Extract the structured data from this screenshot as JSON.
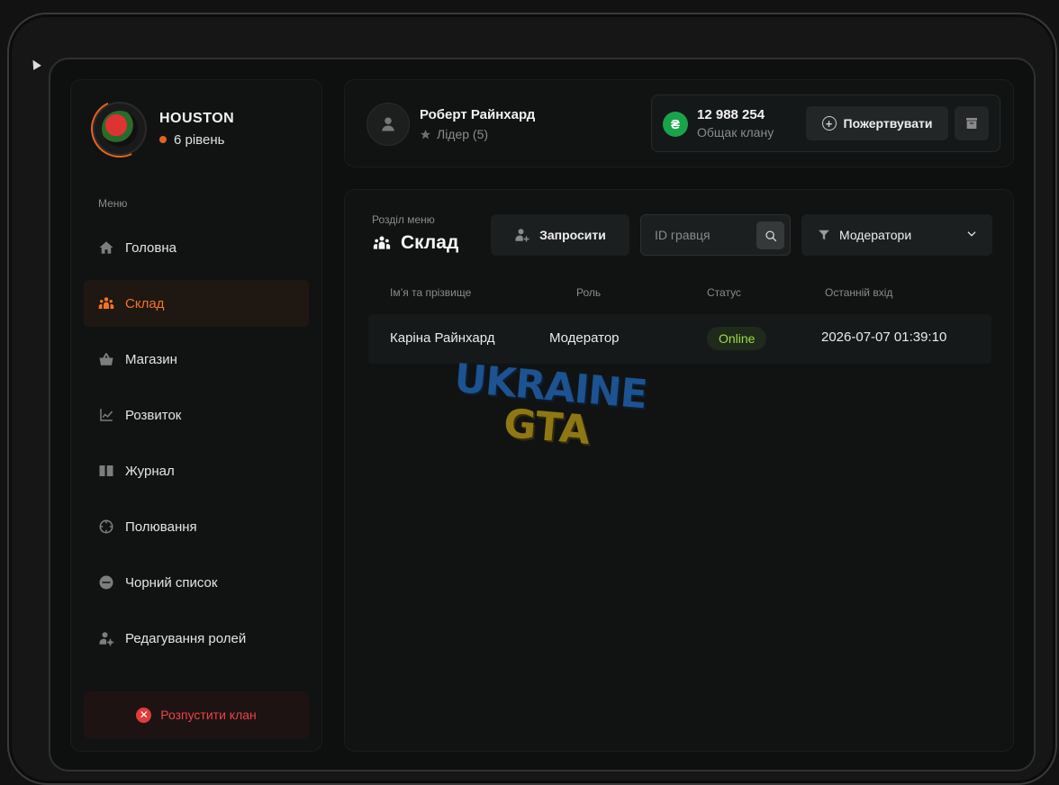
{
  "clan": {
    "name": "HOUSTON",
    "level": "6 рівень"
  },
  "sidebar": {
    "caption": "Меню",
    "items": [
      {
        "label": "Головна",
        "icon": "home-icon"
      },
      {
        "label": "Склад",
        "icon": "team-icon",
        "active": true
      },
      {
        "label": "Магазин",
        "icon": "basket-icon"
      },
      {
        "label": "Розвиток",
        "icon": "chart-line-icon"
      },
      {
        "label": "Журнал",
        "icon": "book-icon"
      },
      {
        "label": "Полювання",
        "icon": "crosshair-icon"
      },
      {
        "label": "Чорний список",
        "icon": "minus-circle-icon"
      },
      {
        "label": "Редагування ролей",
        "icon": "user-gear-icon"
      }
    ],
    "disband_label": "Розпустити клан"
  },
  "user": {
    "name": "Роберт Райнхард",
    "role": "Лідер (5)"
  },
  "treasury": {
    "currency_symbol": "₴",
    "amount": "12 988 254",
    "label": "Общак клану",
    "donate_label": "Пожертвувати"
  },
  "section": {
    "caption": "Розділ меню",
    "title": "Склад",
    "invite_label": "Запросити",
    "search_placeholder": "ID гравця",
    "filter_value": "Модератори"
  },
  "table": {
    "headers": [
      "Ім’я та прізвище",
      "Роль",
      "Статус",
      "Останній вхід"
    ],
    "rows": [
      {
        "name": "Каріна Райнхард",
        "role": "Модератор",
        "status": "Online",
        "last_login": "2026-07-07 01:39:10"
      }
    ]
  },
  "watermark": {
    "line1": "UKRAINE",
    "line2": "GTA"
  },
  "colors": {
    "accent": "#f07328",
    "online": "#9ddc47",
    "danger": "#e84444",
    "currency": "#19a34a"
  }
}
